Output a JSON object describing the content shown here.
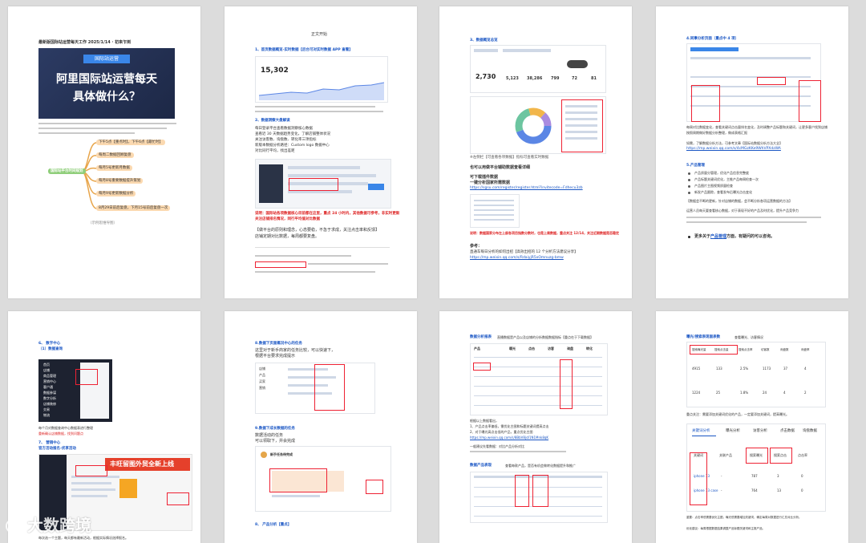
{
  "page1": {
    "title": "最新版国际站运营每天工作 2025/1/14 · 初来乍到",
    "cover_tag": "国际站运营",
    "cover_line1": "阿里国际站运营每天",
    "cover_line2": "具体做什么？",
    "mindmap_center": "国际站平台时间规划",
    "mindmap_items": [
      "下午5点【重点时】，下午6点【最忙时】",
      "每周二数据回顾复盘",
      "每月5号更新月数据",
      "每月8号重要数据提升策划",
      "每月9号更新数据分析",
      "8月29日前后复盘，下月15号前后复盘一次"
    ],
    "caption": "（示例思维导图）"
  },
  "page2": {
    "header": "正文开始",
    "h1": "1、首页数据概览-实时数据【后台可对实时数据 APP 查看】",
    "stat": "15,302",
    "h2": "2、数据洞察大盘解读",
    "p2": [
      "每日登录平台查看数据洞察核心数据",
      "查看近 30 天数据趋势变化，了解店铺整体状况",
      "关注访客数、询盘数、转化率三项指标",
      "新版本数据分析路径：Custom logo 数据中心",
      "对比同行平均，找出差距"
    ],
    "warn1": "说明：国际站各项数据核心目前都在这里，重点 24 小时内，其他数据可参考，非实时更新",
    "warn2": "关注店铺排名情况，同行平均值对比数据",
    "p3": "【做平台的原则和理念，心态要稳，不急于求成，关注点击率和反馈】",
    "p3b": "店铺定期对比数据，每周都要复盘。"
  },
  "page3": {
    "h1": "3、数据概览总览",
    "stat": "2,730",
    "kpis": [
      "5,123",
      "38,286",
      "799",
      "72",
      "81"
    ],
    "note1": "※左侧栏【可查看各项数据】指标可查看实时数据",
    "link1_label": "也可以用做平台辅助数据查看详细",
    "link2_label": "可下载插件数据",
    "link3_label": "一键分析国家所需数据",
    "url1": "https://sgsu.com/register/register.html?invitecode=Fdhecu3zb",
    "warn": "说明：数据国家分布左上部各项目指数分数时，也是上周数据，重点关注 12/14，关注近期数据是否稳定",
    "ref_label": "参考：",
    "ref_text": "直通车每日分析的如何出招【高效出招的 12 个分析方法建议分享】",
    "url2": "https://mp.weixin.qq.com/s/RdaiyjR5xOmnuzg-bmw"
  },
  "page4": {
    "h1": "4.同事分析页面（重点中 4 项）",
    "p1": "每周对比数据变化，查看关键词点击量排名变化，及时调整产品标题和关键词，让更多客户找到店铺",
    "p2": "按照周期做好数据分析整理，做成表格汇报",
    "p3": "如需，了解数据分析方法，可参考文章【国际站数据分析方法大全】",
    "url": "https://mp.weixin.qq.com/s/4cMGzKKe9WhVPXdzWA",
    "h2": "5.产品管理",
    "bullets": [
      "产品质量分管理，优化产品信息完整度",
      "产品标题关键词优化，主推产品每周检查一次",
      "产品图片主图视频质量检查",
      "新发产品跟踪，查看发布后曝光点击变化"
    ],
    "p4": "【数据会不断的更新，针对店铺的数据，会不断分析各项运营数据的方法】",
    "p5": "运营人员每天要查看核心数据，对于表现不好的产品及时优化，提升产品竞争力",
    "foot_prefix": "更多关于",
    "foot_link": "产品管理",
    "foot_suffix": "方面，有疑问的可以咨询。"
  },
  "page5": {
    "h1": "6、 数字中心",
    "h1b": "（1）数据查询",
    "menu": [
      "首页",
      "店铺",
      "商品管理",
      "营销中心",
      "客户通",
      "数据参谋",
      "数字分析",
      "店铺装修",
      "交易",
      "物流"
    ],
    "p1": "每个月对数据查询中心数据表进行整理",
    "p1b": "重新确认店铺数据，找到问题点",
    "h2": "7、 营销中心",
    "h2b": "官方活动报名-优享活动",
    "banner": "丰旺留图外贸全新上线",
    "p2": "每次选一个主题，每天都有最新活动，根据实际情况选择报名。"
  },
  "page6": {
    "h1": "8.数据下页面概况中心的任务",
    "p1": "这里对于新手商家的任务比较，可以快速下，",
    "p1b": "根据平台要求完成提示",
    "h2": "9.数据下成长数据的任务",
    "p2": "数据活动的任务",
    "p2b": "可以领取下，并会完成",
    "h3": "8、 产品分析【重点】",
    "list_left": [
      "店铺",
      "产品",
      "买家",
      "营销"
    ],
    "dialog_title": "新手任务待完成"
  },
  "page7": {
    "h1": "数据分析报表",
    "h1_note": "直播数据是产品以及店铺的分析数据数据指标【重点在于下载数据】",
    "cols": [
      "产品",
      "曝光",
      "点击",
      "访客",
      "询盘",
      "转化"
    ],
    "p1": "根据以上数据看出，",
    "p1b": "1、产品点击率偏低，需优化主图和标题关键词提高点击",
    "p1c": "2、对于曝光高点击低的产品，重点优化主图",
    "url": "https://mp.weixin.qq.com/s/8BbV8jd/1N1Mnk8qK",
    "p1d": "一般建议先看数据：对比产品分析对比",
    "h2": "数据产品表现",
    "h2_note": "查看每款产品，是否有机会做转化数据提升和推广"
  },
  "page8": {
    "h1": "曝光/搜索表现面表数",
    "h1_note": "查看曝光、访客情况",
    "tabs": [
      "搜索曝光量",
      "搜索点击量",
      "搜索点击率",
      "访客数",
      "询盘数",
      "询盘率"
    ],
    "row1": [
      "4915",
      "133",
      "2.5%",
      "1173",
      "37",
      "4"
    ],
    "row2": [
      "1224",
      "25",
      "1.8%",
      "24",
      "4",
      "2"
    ],
    "p1": "重点关注：需要添加关键词优化的产品，一定要添加关键词，提高曝光。",
    "tabs2": [
      "关键词分析",
      "曝光分析",
      "访客分析",
      "点击数据",
      "询盘数据"
    ],
    "kw_head": [
      "关键词",
      "关联产品",
      "搜索曝光",
      "搜索点击",
      "点击率"
    ],
    "kw_rows": [
      [
        "iphone 13",
        "-",
        "787",
        "3",
        "0"
      ],
      [
        "iphone 13 case",
        "-",
        "764",
        "13",
        "0"
      ]
    ],
    "p2": "重要：点击率低需要优化主图，曝光低需要增加关键词，确定每周对数据进行汇总对比分析。",
    "p3": "优化建议：每周根据数据结果调整产品标题关键词和主推产品。"
  },
  "watermark": "大数跨境",
  "colors": {
    "accent_blue": "#1a56c4",
    "warn_red": "#dd2222",
    "cover_bg": "#27365a",
    "banner_red": "#e5402b"
  }
}
